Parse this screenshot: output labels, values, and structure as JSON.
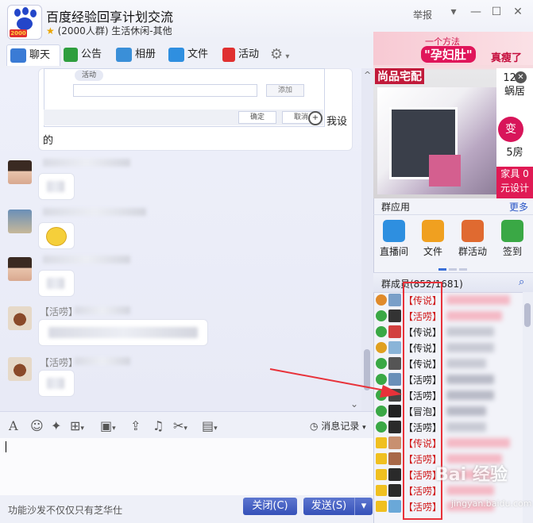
{
  "window": {
    "title": "百度经验回享计划交流",
    "subtitle": "(2000人群) 生活休闲-其他",
    "logo_badge": "2000",
    "report_label": "举报",
    "controls": {
      "dropdown": "▾",
      "minimize": "—",
      "maximize": "☐",
      "close": "✕"
    }
  },
  "tabs": [
    {
      "label": "聊天",
      "icon": "chat-icon",
      "color": "#3a7bd5"
    },
    {
      "label": "公告",
      "icon": "flag-icon",
      "color": "#2e9e3e"
    },
    {
      "label": "相册",
      "icon": "photo-icon",
      "color": "#3a8fd8"
    },
    {
      "label": "文件",
      "icon": "folder-icon",
      "color": "#2f8fe0"
    },
    {
      "label": "活动",
      "icon": "event-flag-icon",
      "color": "#e03030"
    }
  ],
  "chat": {
    "screenshot_activity_tag": "活动",
    "screenshot_add_button": "添加",
    "screenshot_ok_button": "确定",
    "screenshot_cancel_button": "取消",
    "message_tail": "我设",
    "message_tail2": "的",
    "sender_prefix_1": "【活唠】",
    "sender_prefix_2": "【活唠】"
  },
  "toolbar": {
    "history_label": "消息记录"
  },
  "footer": {
    "text": "功能沙发不仅仅只有芝华仕",
    "close_button": "关闭(C)",
    "send_button": "发送(S)"
  },
  "ad": {
    "slogan_small": "一个方法",
    "slogan_pill": "\"孕妇肚\"",
    "slogan_end": "真瘦了",
    "brand": "尚品宅配",
    "side_text": "12m 蜗居",
    "side_circle": "变",
    "side_text2": "5房",
    "bottom_text": "家具 0元设计"
  },
  "apps": {
    "title": "群应用",
    "more": "更多",
    "items": [
      {
        "label": "直播间",
        "icon": "live-room-icon",
        "color": "#2e8fe0"
      },
      {
        "label": "文件",
        "icon": "file-icon",
        "color": "#f0a020"
      },
      {
        "label": "群活动",
        "icon": "group-event-icon",
        "color": "#e06a30"
      },
      {
        "label": "签到",
        "icon": "checkin-icon",
        "color": "#3aa845"
      }
    ]
  },
  "members": {
    "title": "群成员(852/1681)",
    "list": [
      {
        "tag": "【传说】",
        "color": "#d01818"
      },
      {
        "tag": "【活唠】",
        "color": "#d01818"
      },
      {
        "tag": "【传说】",
        "color": "#222222"
      },
      {
        "tag": "【传说】",
        "color": "#222222"
      },
      {
        "tag": "【传说】",
        "color": "#222222"
      },
      {
        "tag": "【活唠】",
        "color": "#222222"
      },
      {
        "tag": "【活唠】",
        "color": "#222222"
      },
      {
        "tag": "【冒泡】",
        "color": "#222222"
      },
      {
        "tag": "【活唠】",
        "color": "#222222"
      },
      {
        "tag": "【传说】",
        "color": "#d01818"
      },
      {
        "tag": "【活唠】",
        "color": "#d01818"
      },
      {
        "tag": "【活唠】",
        "color": "#d01818"
      },
      {
        "tag": "【活唠】",
        "color": "#d01818"
      },
      {
        "tag": "【活唠】",
        "color": "#d01818"
      }
    ]
  },
  "watermark": {
    "text": "Bai 经验",
    "url": "jingyan.baidu.com"
  }
}
